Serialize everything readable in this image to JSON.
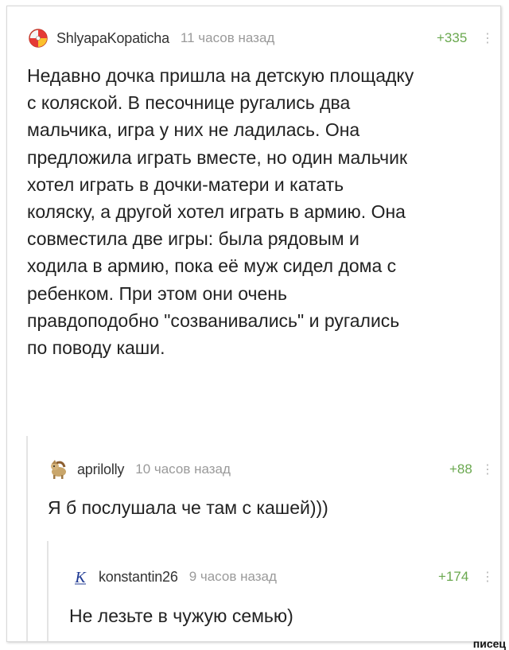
{
  "comments": [
    {
      "username": "ShlyapaKopaticha",
      "time": "11 часов назад",
      "rating": "+335",
      "avatar_icon": "beachball-avatar-icon",
      "text_lines": [
        "Недавно дочка пришла на детскую площадку",
        "с коляской. В песочнице ругались два",
        "мальчика, игра у них не ладилась. Она",
        "предложила играть вместе, но один мальчик",
        "хотел играть в дочки-матери и катать",
        "коляску, а другой хотел играть в армию. Она",
        "совместила две игры: была рядовым и",
        "ходила в армию, пока её муж сидел дома с",
        "ребенком. При этом они очень",
        "правдоподобно \"созванивались\" и ругались",
        "по поводу каши."
      ]
    },
    {
      "username": "aprilolly",
      "time": "10 часов назад",
      "rating": "+88",
      "avatar_icon": "pony-avatar-icon",
      "text_lines": [
        "Я б послушала че там с кашей)))"
      ]
    },
    {
      "username": "konstantin26",
      "time": "9 часов назад",
      "rating": "+174",
      "avatar_icon": "k-letter-avatar-icon",
      "text_lines": [
        "Не лезьте в чужую семью)"
      ]
    }
  ],
  "menu_glyph": "⋮",
  "watermark": "писец",
  "colors": {
    "rating_green": "#6aa84f",
    "text": "#222222",
    "meta_gray": "#9a9a9a"
  }
}
